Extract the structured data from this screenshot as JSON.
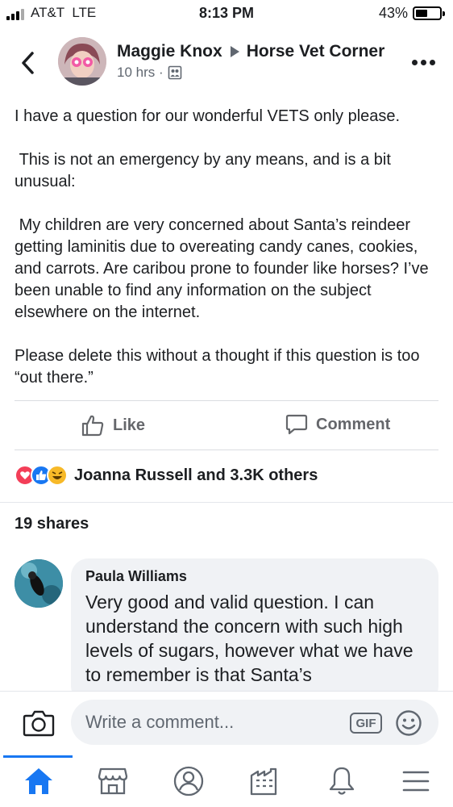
{
  "status_bar": {
    "carrier": "AT&T  LTE",
    "time": "8:13 PM",
    "battery": "43%",
    "battery_level": 0.43
  },
  "post": {
    "author": "Maggie Knox",
    "group": "Horse Vet Corner",
    "time_ago": "10 hrs ·",
    "privacy_icon": "group-icon",
    "paragraphs": [
      "I have a question for our wonderful VETS only please.",
      " This is not an emergency by any means, and is a bit unusual:",
      " My children are very concerned about Santa’s reindeer getting laminitis due to overeating candy canes, cookies, and carrots. Are caribou prone to founder like horses? I’ve been unable to find any information on the subject elsewhere on the internet.",
      "Please delete this without a thought if this question is too “out there.”"
    ]
  },
  "actions": {
    "like": "Like",
    "comment": "Comment"
  },
  "reactions": {
    "icons": [
      "love-icon",
      "like-icon",
      "haha-icon"
    ],
    "summary": "Joanna Russell and 3.3K others"
  },
  "shares": "19 shares",
  "comment": {
    "author": "Paula Williams",
    "text": "Very good and valid question. I can understand the concern with such high levels of sugars, however what we have to remember is that Santa’s"
  },
  "composer": {
    "placeholder": "Write a comment...",
    "gif": "GIF"
  },
  "tabbar": {
    "items": [
      "home-icon",
      "marketplace-icon",
      "profile-icon",
      "pages-icon",
      "notifications-icon",
      "menu-icon"
    ],
    "active": "home-icon"
  },
  "colors": {
    "accent": "#1877f2",
    "text": "#1c1e21",
    "secondary": "#606770",
    "bubble": "#f0f2f5"
  }
}
